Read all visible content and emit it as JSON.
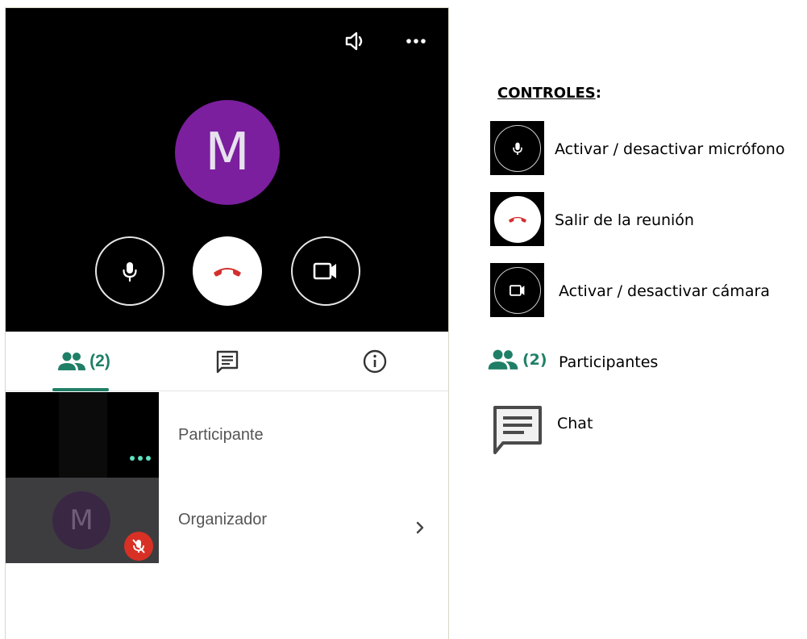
{
  "meeting": {
    "main_avatar_letter": "M",
    "participant_count": "(2)",
    "participants": [
      {
        "name": "Participante"
      },
      {
        "name": "Organizador",
        "avatar_letter": "M"
      }
    ]
  },
  "legend": {
    "title": "CONTROLES",
    "title_suffix": ":",
    "items": [
      {
        "label": "Activar / desactivar micrófono",
        "icon": "mic-icon"
      },
      {
        "label": "Salir de la reunión",
        "icon": "hangup-icon"
      },
      {
        "label": "Activar / desactivar cámara",
        "icon": "camera-icon"
      },
      {
        "label": "Participantes",
        "icon": "people-icon",
        "count": "(2)"
      },
      {
        "label": "Chat",
        "icon": "chat-icon"
      }
    ]
  },
  "colors": {
    "video_bg": "#000000",
    "avatar": "#7b1f9e",
    "accent_green": "#1f7f66",
    "hangup_red": "#d93025"
  }
}
